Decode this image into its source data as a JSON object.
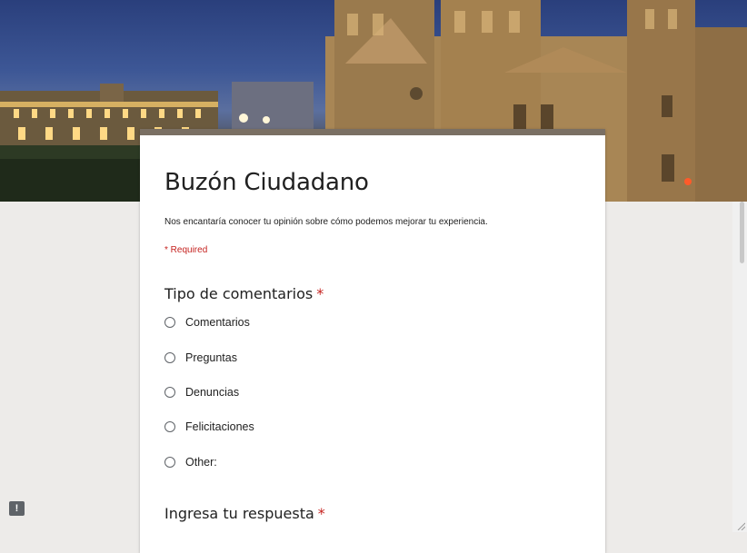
{
  "form": {
    "title": "Buzón Ciudadano",
    "description": "Nos encantaría conocer tu opinión sobre cómo podemos mejorar tu experiencia.",
    "required_note": "* Required"
  },
  "questions": {
    "q1": {
      "title": "Tipo de comentarios",
      "required_mark": "*",
      "options": [
        "Comentarios",
        "Preguntas",
        "Denuncias",
        "Felicitaciones",
        "Other:"
      ]
    },
    "q2": {
      "title": "Ingresa tu respuesta",
      "required_mark": "*"
    }
  },
  "feedback_button": {
    "icon": "!"
  },
  "colors": {
    "accent_bar": "#7a6f63",
    "required": "#c5221f",
    "background": "#edebe9"
  }
}
